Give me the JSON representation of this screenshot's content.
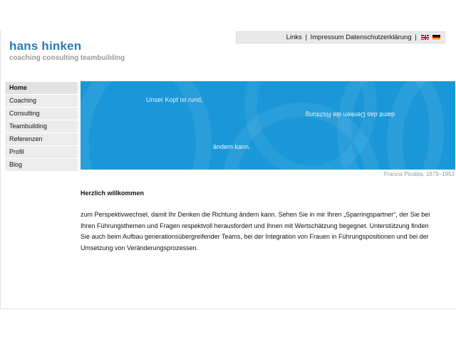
{
  "topnav": {
    "links": "Links",
    "sep1": "|",
    "impressum": "Impressum",
    "datenschutz": "Datenschutzerklärung",
    "sep2": "|",
    "flags": [
      "uk-flag-icon",
      "german-flag-icon"
    ]
  },
  "logo": {
    "title": "hans hinken",
    "subtitle": "coaching consulting teambuilding"
  },
  "nav": {
    "items": [
      {
        "label": "Home",
        "active": true
      },
      {
        "label": "Coaching"
      },
      {
        "label": "Consulting"
      },
      {
        "label": "Teambuilding"
      },
      {
        "label": "Referenzen"
      },
      {
        "label": "Profil"
      },
      {
        "label": "Blog"
      }
    ]
  },
  "banner": {
    "line1": "Unser Kopf ist rund,",
    "line2": "damit das Denken die Richtung",
    "line3": "ändern kann.",
    "caption": "Francis Picabia, 1879–1953",
    "color": "#1a97d8"
  },
  "content": {
    "heading": "Herzlich willkommen",
    "paragraph": "zum Perspektivwechsel, damit Ihr Denken die Richtung ändern kann. Sehen Sie in mir Ihren „Sparringspartner“, der Sie bei Ihren Führungsthemen und Fragen respektvoll herausfordert und Ihnen mit Wertschätzung begegnet. Unterstützung finden Sie auch beim Aufbau generationsübergreifender Teams, bei der Integration von Frauen in Führungspositionen und bei der Umsetzung von Veränderungsprozessen."
  }
}
